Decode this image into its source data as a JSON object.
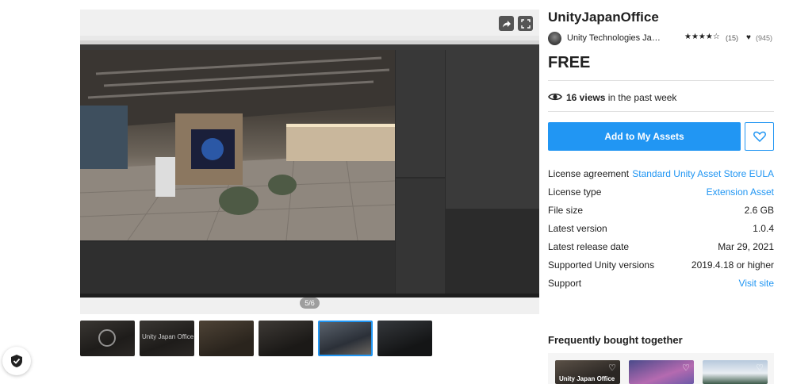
{
  "gallery": {
    "counter": "5/6",
    "share_icon": "share-icon",
    "fullscreen_icon": "fullscreen-icon",
    "thumbnail_labels": [
      "",
      "Unity Japan Office",
      "",
      "",
      "",
      ""
    ]
  },
  "product": {
    "title": "UnityJapanOffice",
    "publisher": "Unity Technologies Jap...",
    "stars": "★★★★☆",
    "rating_count": "(15)",
    "favorites": "(945)",
    "price": "FREE",
    "views_count": "16 views",
    "views_suffix": " in the past week",
    "add_button": "Add to My Assets"
  },
  "details": [
    {
      "key": "License agreement",
      "value": "Standard Unity Asset Store EULA",
      "link": true
    },
    {
      "key": "License type",
      "value": "Extension Asset",
      "link": true
    },
    {
      "key": "File size",
      "value": "2.6 GB",
      "link": false
    },
    {
      "key": "Latest version",
      "value": "1.0.4",
      "link": false
    },
    {
      "key": "Latest release date",
      "value": "Mar 29, 2021",
      "link": false
    },
    {
      "key": "Supported Unity versions",
      "value": "2019.4.18 or higher",
      "link": false
    },
    {
      "key": "Support",
      "value": "Visit site",
      "link": true
    }
  ],
  "frequently_bought": {
    "title": "Frequently bought together",
    "card1_label": "Unity Japan Office"
  },
  "colors": {
    "accent": "#2196f3",
    "text": "#212121"
  }
}
